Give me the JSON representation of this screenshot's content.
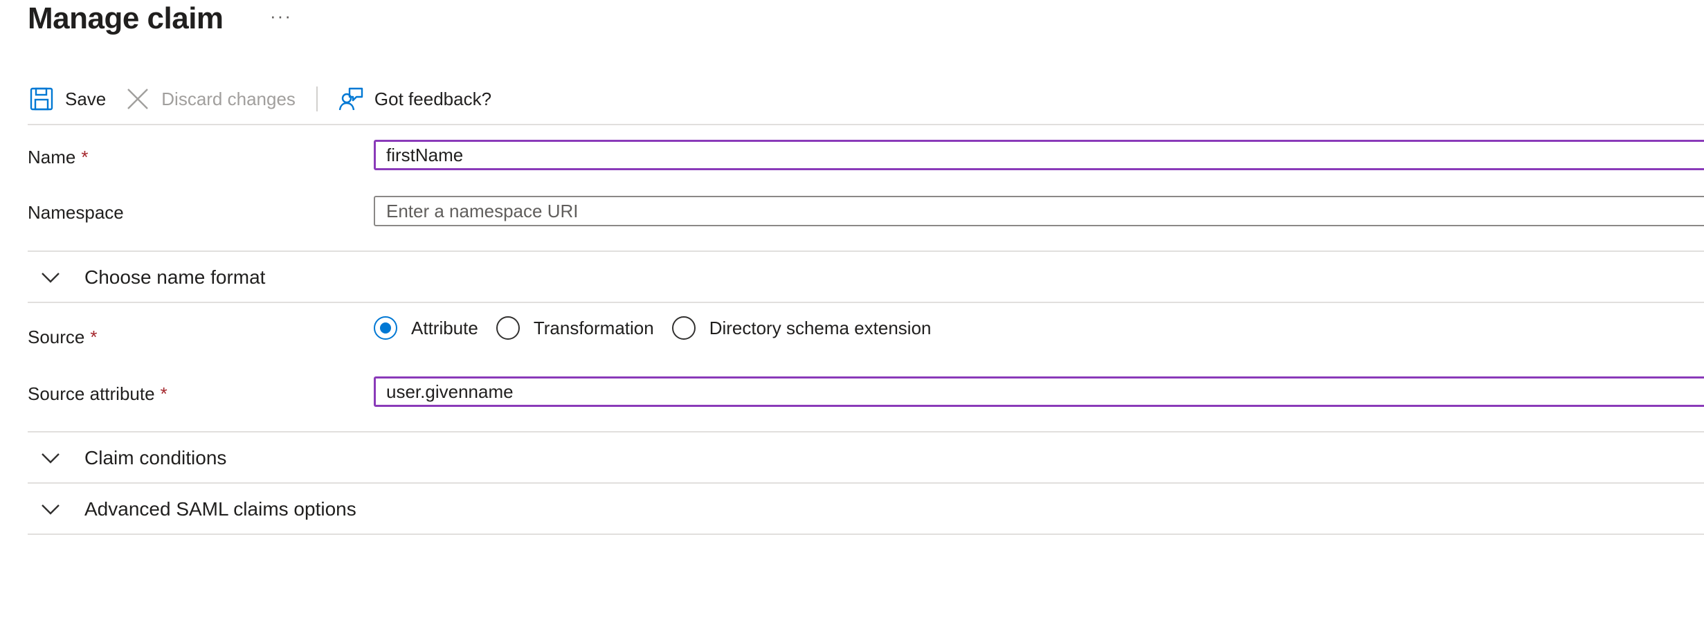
{
  "header": {
    "title": "Manage claim",
    "more_label": "···"
  },
  "toolbar": {
    "save_label": "Save",
    "discard_label": "Discard changes",
    "feedback_label": "Got feedback?"
  },
  "form": {
    "name": {
      "label": "Name",
      "required_mark": "*",
      "value": "firstName"
    },
    "namespace": {
      "label": "Namespace",
      "value": "",
      "placeholder": "Enter a namespace URI"
    },
    "name_format_section": {
      "label": "Choose name format"
    },
    "source": {
      "label": "Source",
      "required_mark": "*",
      "options": [
        "Attribute",
        "Transformation",
        "Directory schema extension"
      ],
      "selected": "Attribute"
    },
    "source_attribute": {
      "label": "Source attribute",
      "required_mark": "*",
      "value": "user.givenname"
    },
    "claim_conditions_section": {
      "label": "Claim conditions"
    },
    "advanced_section": {
      "label": "Advanced SAML claims options"
    }
  },
  "colors": {
    "accent": "#0078d4",
    "focus_border": "#8a3ab9",
    "required": "#a4262c",
    "disabled_text": "#a19f9d"
  },
  "icons": {
    "save": "save-icon",
    "discard": "close-icon",
    "feedback": "feedback-icon",
    "chevron": "chevron-down-icon"
  }
}
